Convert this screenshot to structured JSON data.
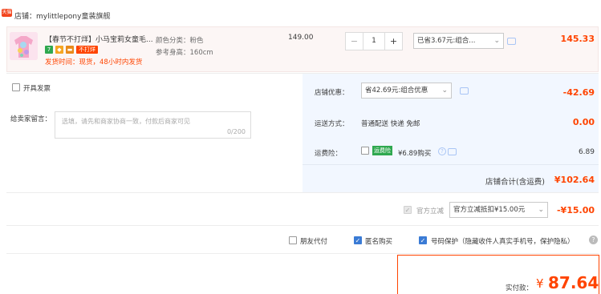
{
  "shop": {
    "badge": "天猫",
    "label": "店铺：mylittlepony童装旗舰"
  },
  "item": {
    "title": "【春节不打烊】小马宝莉女童毛...",
    "tag_no_close": "不打烊",
    "shipping_note": "发货时间：现货，48小时内发货",
    "sku_color": "颜色分类：粉色",
    "sku_height": "参考身高：160cm",
    "unit_price": "149.00",
    "qty_minus": "−",
    "qty": "1",
    "qty_plus": "+",
    "promo_select": "已省3.67元:组合...",
    "subtotal": "145.33"
  },
  "invoice": {
    "label": "开具发票"
  },
  "message": {
    "label": "给卖家留言：",
    "placeholder": "选填，请先和商家协商一致，付款后商家可见",
    "counter": "0/200"
  },
  "shop_discount": {
    "label": "店铺优惠：",
    "select": "省42.69元:组合优惠",
    "amount": "-42.69"
  },
  "delivery": {
    "label": "运送方式：",
    "value": "普通配送 快递 免邮",
    "amount": "0.00"
  },
  "insurance": {
    "label": "运费险：",
    "badge": "运费险",
    "text": "¥6.89购买",
    "amount": "6.89"
  },
  "shop_total": {
    "label": "店铺合计(含运费)",
    "amount": "¥102.64"
  },
  "official": {
    "label": "官方立减",
    "select": "官方立减抵扣¥15.00元",
    "amount": "-¥15.00"
  },
  "options": {
    "friend_pay": "朋友代付",
    "anonymous": "匿名购买",
    "privacy": "号码保护（隐藏收件人真实手机号，保护隐私）"
  },
  "final": {
    "label": "实付款：",
    "currency": "¥",
    "amount": "87.64"
  },
  "colors": {
    "accent": "#ff4400",
    "blue": "#3a7bd5",
    "panel": "#f2f7ff"
  }
}
